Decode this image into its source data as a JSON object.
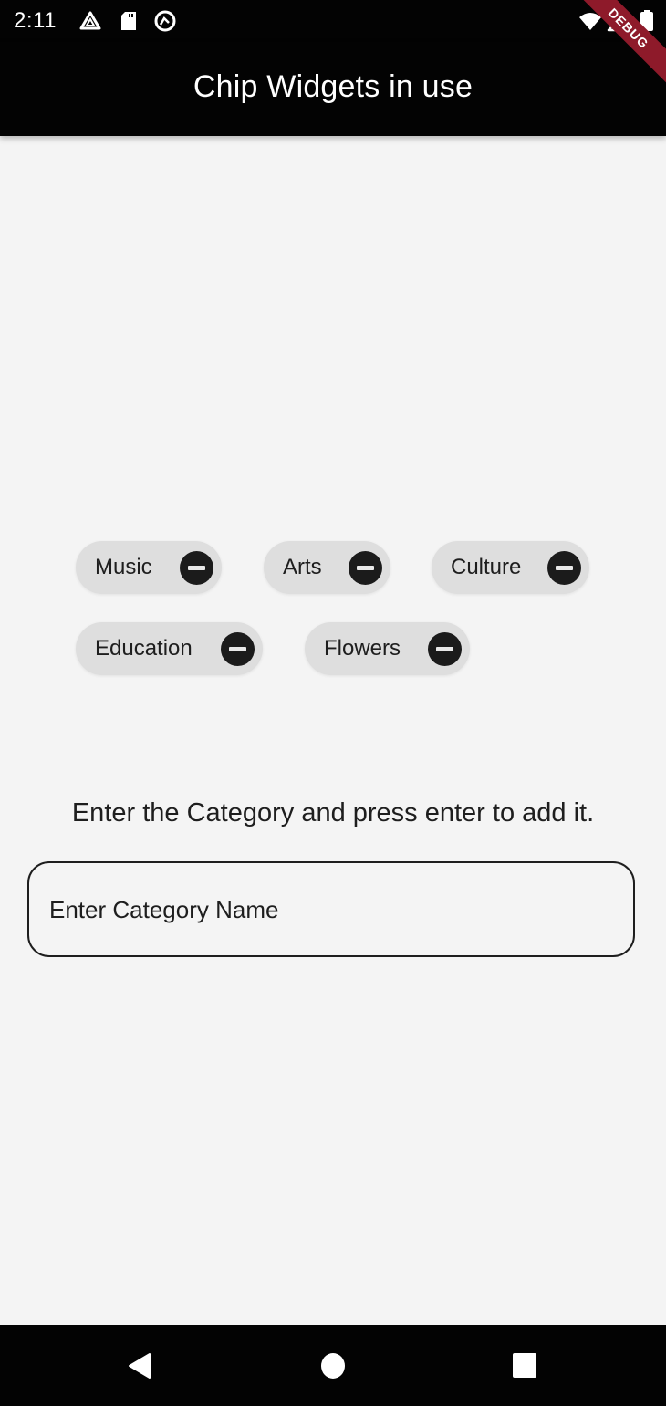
{
  "status_bar": {
    "time": "2:11",
    "left_icons": [
      "drive-icon",
      "sd-card-icon",
      "sync-icon"
    ],
    "right_icons": [
      "wifi-icon",
      "signal-icon",
      "battery-icon"
    ]
  },
  "app_bar": {
    "title": "Chip Widgets in use",
    "debug_banner": "DEBUG"
  },
  "chips": [
    {
      "label": "Music"
    },
    {
      "label": "Arts"
    },
    {
      "label": "Culture"
    },
    {
      "label": "Education"
    },
    {
      "label": "Flowers"
    }
  ],
  "form": {
    "prompt": "Enter the Category and press enter to add it.",
    "input_value": "",
    "input_placeholder": "Enter Category Name"
  },
  "nav_bar": {
    "buttons": [
      "back",
      "home",
      "recents"
    ]
  },
  "colors": {
    "bar_background": "#030303",
    "page_background": "#f4f4f4",
    "chip_background": "#dedede",
    "chip_delete": "#1b1b1b",
    "debug_banner": "#8e1a2a"
  }
}
